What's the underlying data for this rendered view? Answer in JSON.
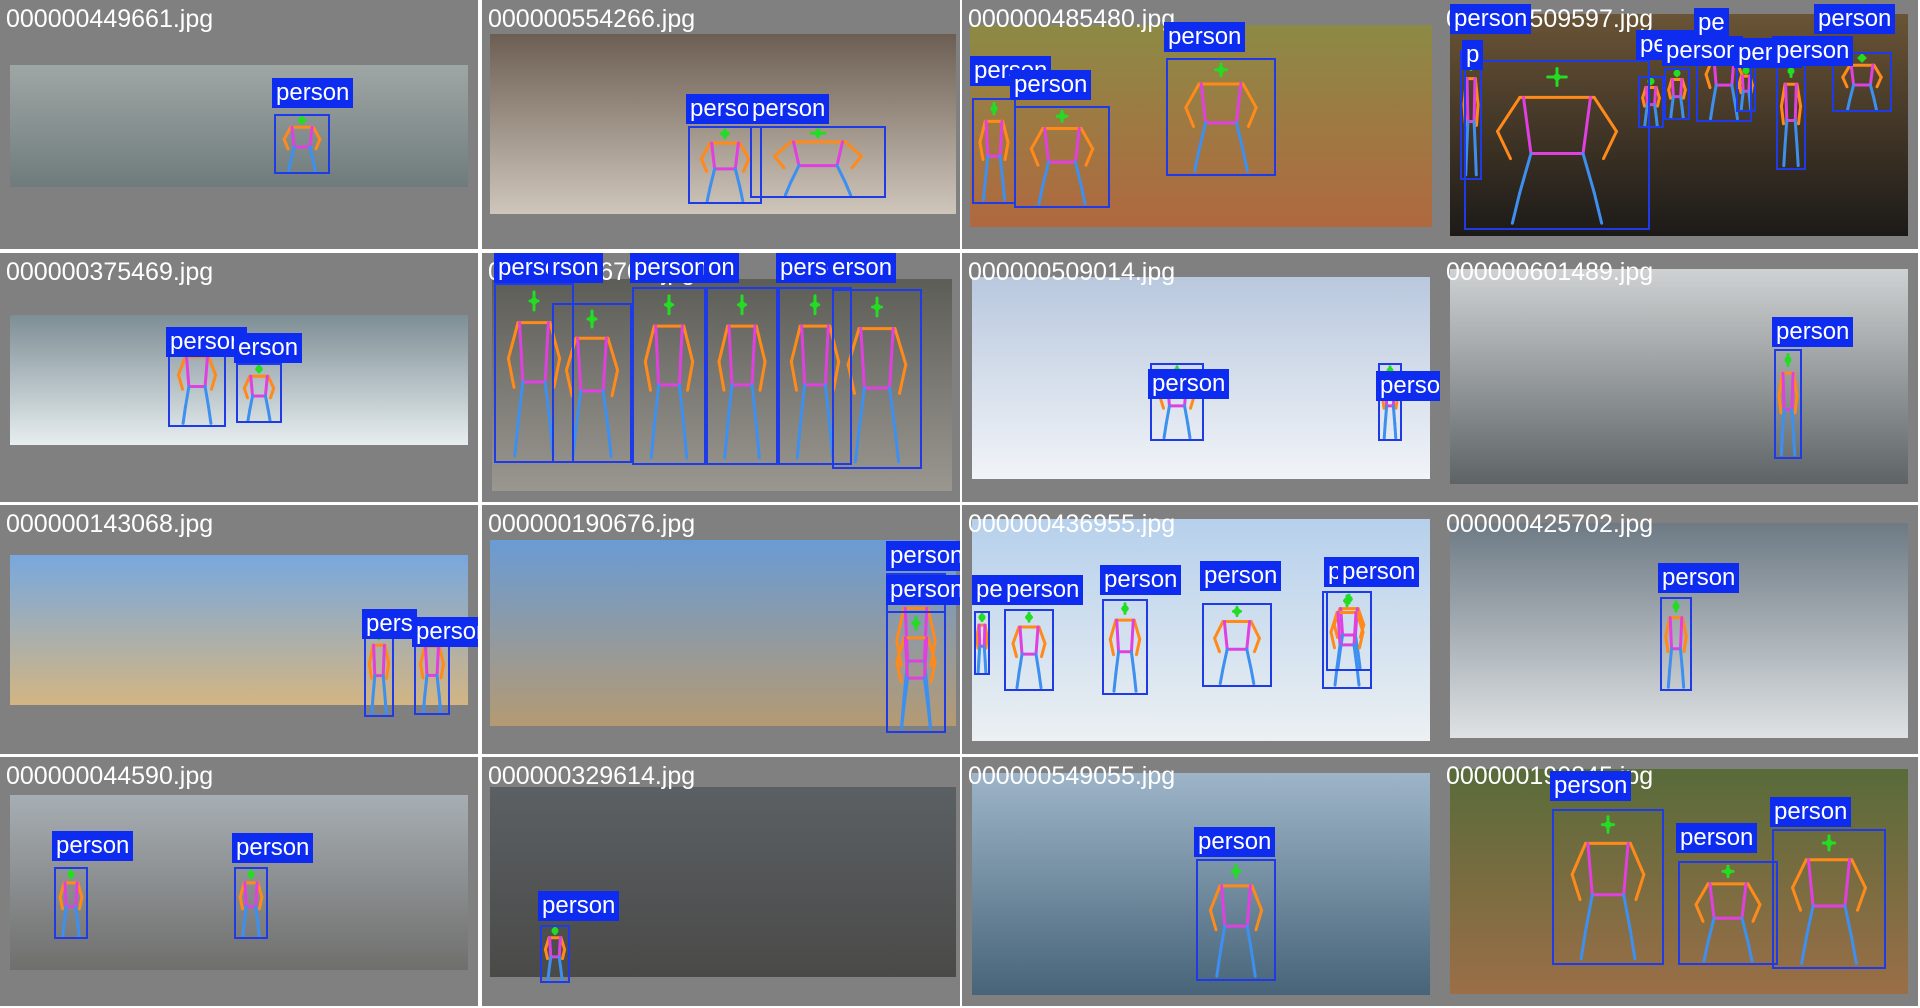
{
  "label_text": "person",
  "colors": {
    "tile_bg": "#808080",
    "box": "#1f3be8",
    "label_bg": "#0d2cf0",
    "label_text": "#ffffff",
    "kp_head": "#22dd22",
    "kp_arms": "#ff8a1a",
    "kp_torso": "#e040e0",
    "kp_legs": "#3d8ff0"
  },
  "tiles": [
    {
      "filename": "000000449661.jpg",
      "scene": "hospital room",
      "person_count": 1
    },
    {
      "filename": "000000554266.jpg",
      "scene": "bedroom panorama",
      "person_count": 2,
      "label_overrides": [
        "perso",
        "person"
      ]
    },
    {
      "filename": "000000485480.jpg",
      "scene": "baseball field",
      "person_count": 3
    },
    {
      "filename": "000000509597.jpg",
      "scene": "crowded restaurant",
      "person_count": 8,
      "label_overrides": [
        "person",
        "p",
        "person",
        "person",
        "pe",
        "perso",
        "person",
        "person"
      ]
    },
    {
      "filename": "000000375469.jpg",
      "scene": "surfing wave",
      "person_count": 2,
      "label_overrides": [
        "person",
        "erson"
      ]
    },
    {
      "filename": "000000306700.jpg",
      "scene": "vintage group photo",
      "person_count": 6,
      "label_overrides": [
        "person",
        "rson",
        "person",
        "on",
        "person",
        "erson"
      ]
    },
    {
      "filename": "000000509014.jpg",
      "scene": "ski slope",
      "person_count": 2
    },
    {
      "filename": "000000601489.jpg",
      "scene": "paddle board lake",
      "person_count": 1
    },
    {
      "filename": "000000143068.jpg",
      "scene": "beach kites",
      "person_count": 2,
      "label_overrides": [
        "pers",
        "person"
      ]
    },
    {
      "filename": "000000190676.jpg",
      "scene": "airport tarmac",
      "person_count": 2
    },
    {
      "filename": "000000436955.jpg",
      "scene": "ski race",
      "person_count": 5,
      "label_overrides": [
        "pe",
        "person",
        "person",
        "person",
        "person"
      ]
    },
    {
      "filename": "000000425702.jpg",
      "scene": "beach surfboard",
      "person_count": 1
    },
    {
      "filename": "000000044590.jpg",
      "scene": "motorcycles beach",
      "person_count": 2
    },
    {
      "filename": "000000329614.jpg",
      "scene": "cathedral street",
      "person_count": 1
    },
    {
      "filename": "000000549055.jpg",
      "scene": "wave surfing",
      "person_count": 1
    },
    {
      "filename": "000000190845.jpg",
      "scene": "baseball batter",
      "person_count": 3
    }
  ]
}
